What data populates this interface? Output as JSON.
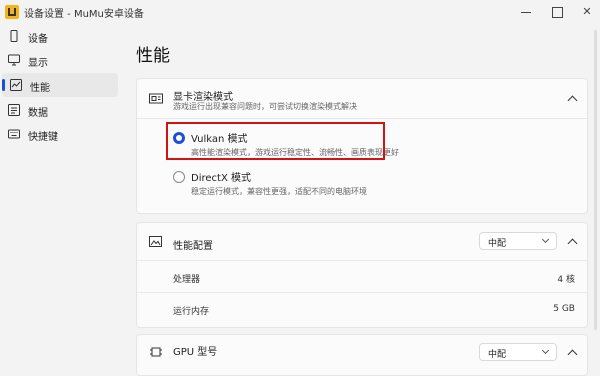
{
  "window": {
    "title": "设备设置 - MuMu安卓设备"
  },
  "sidebar": {
    "items": [
      {
        "label": "设备",
        "icon": "phone-icon"
      },
      {
        "label": "显示",
        "icon": "monitor-icon"
      },
      {
        "label": "性能",
        "icon": "performance-icon",
        "active": true
      },
      {
        "label": "数据",
        "icon": "data-icon"
      },
      {
        "label": "快捷键",
        "icon": "keyboard-icon"
      }
    ]
  },
  "page": {
    "title": "性能"
  },
  "render_mode": {
    "title": "显卡渲染模式",
    "subtitle": "游戏运行出现兼容问题时，可尝试切换渲染模式解决",
    "options": [
      {
        "title": "Vulkan 模式",
        "desc": "高性能渲染模式，游戏运行稳定性、流畅性、画质表现更好",
        "selected": true
      },
      {
        "title": "DirectX 模式",
        "desc": "稳定运行模式，兼容性更强，适配不同的电脑环境",
        "selected": false
      }
    ]
  },
  "perf_config": {
    "title": "性能配置",
    "selected": "中配",
    "rows": [
      {
        "label": "处理器",
        "value": "4 核"
      },
      {
        "label": "运行内存",
        "value": "5 GB"
      }
    ]
  },
  "gpu": {
    "title": "GPU 型号",
    "selected": "中配"
  },
  "colors": {
    "accent": "#1a4fd8",
    "highlight": "#d01414"
  }
}
